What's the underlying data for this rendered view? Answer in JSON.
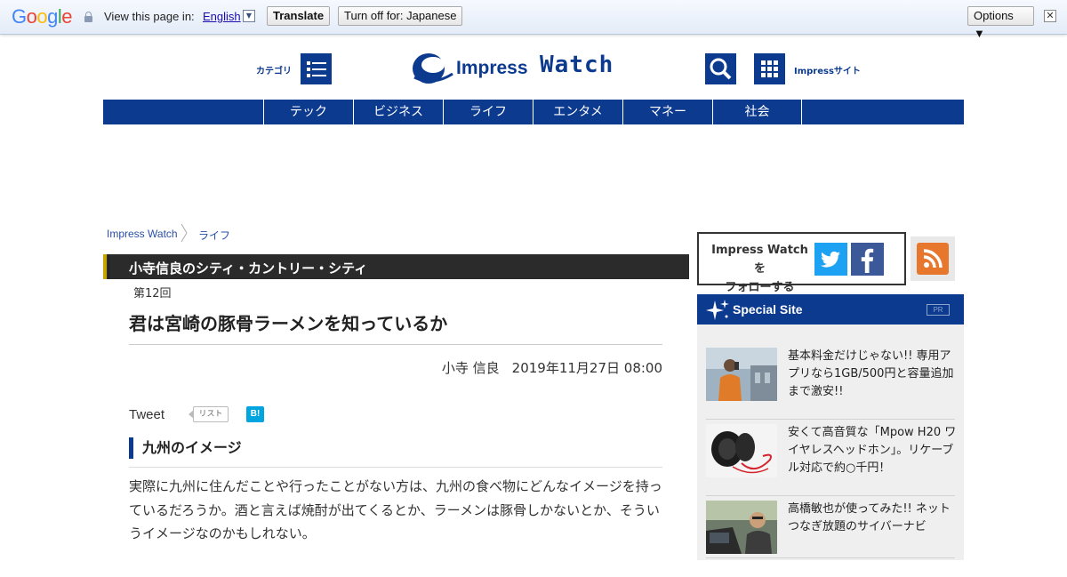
{
  "translate_bar": {
    "logo": "Google",
    "prompt": "View this page in:",
    "language": "English",
    "translate_label": "Translate",
    "turn_off_label": "Turn off for: Japanese",
    "options_label": "Options ▼",
    "close_glyph": "✕"
  },
  "header": {
    "category_label": "カテゴリ",
    "logo_word1": "Impress",
    "logo_word2": "Watch",
    "impress_sites_label": "Impressサイト"
  },
  "nav": {
    "items": [
      "テック",
      "ビジネス",
      "ライフ",
      "エンタメ",
      "マネー",
      "社会"
    ]
  },
  "breadcrumb": {
    "home": "Impress Watch",
    "section": "ライフ"
  },
  "article": {
    "series": "小寺信良のシティ・カントリー・シティ",
    "episode": "第12回",
    "title": "君は宮崎の豚骨ラーメンを知っているか",
    "author": "小寺 信良",
    "date": "2019年11月27日 08:00",
    "tweet_label": "Tweet",
    "list_label": "リスト",
    "hatena_label": "B!",
    "section_heading": "九州のイメージ",
    "body": "実際に九州に住んだことや行ったことがない方は、九州の食べ物にどんなイメージを持っているだろうか。酒と言えば焼酎が出てくるとか、ラーメンは豚骨しかないとか、そういうイメージなのかもしれない。"
  },
  "sidebar": {
    "follow_line1": "Impress Watch を",
    "follow_line2": "フォローする",
    "special_title": "Special Site",
    "pr_label": "PR",
    "items": [
      {
        "text": "基本料金だけじゃない!! 専用アプリなら1GB/500円と容量追加まで激安!!"
      },
      {
        "text": "安くて高音質な「Mpow H20 ワイヤレスヘッドホン」。リケーブル対応で約○千円！"
      },
      {
        "text": "高橋敏也が使ってみた!! ネットつなぎ放題のサイバーナビ"
      }
    ]
  },
  "colors": {
    "brand": "#0c3a8f",
    "series_bar": "#2b2b2b",
    "twitter": "#1da1f2",
    "facebook": "#3b5998",
    "rss": "#e8772e"
  }
}
